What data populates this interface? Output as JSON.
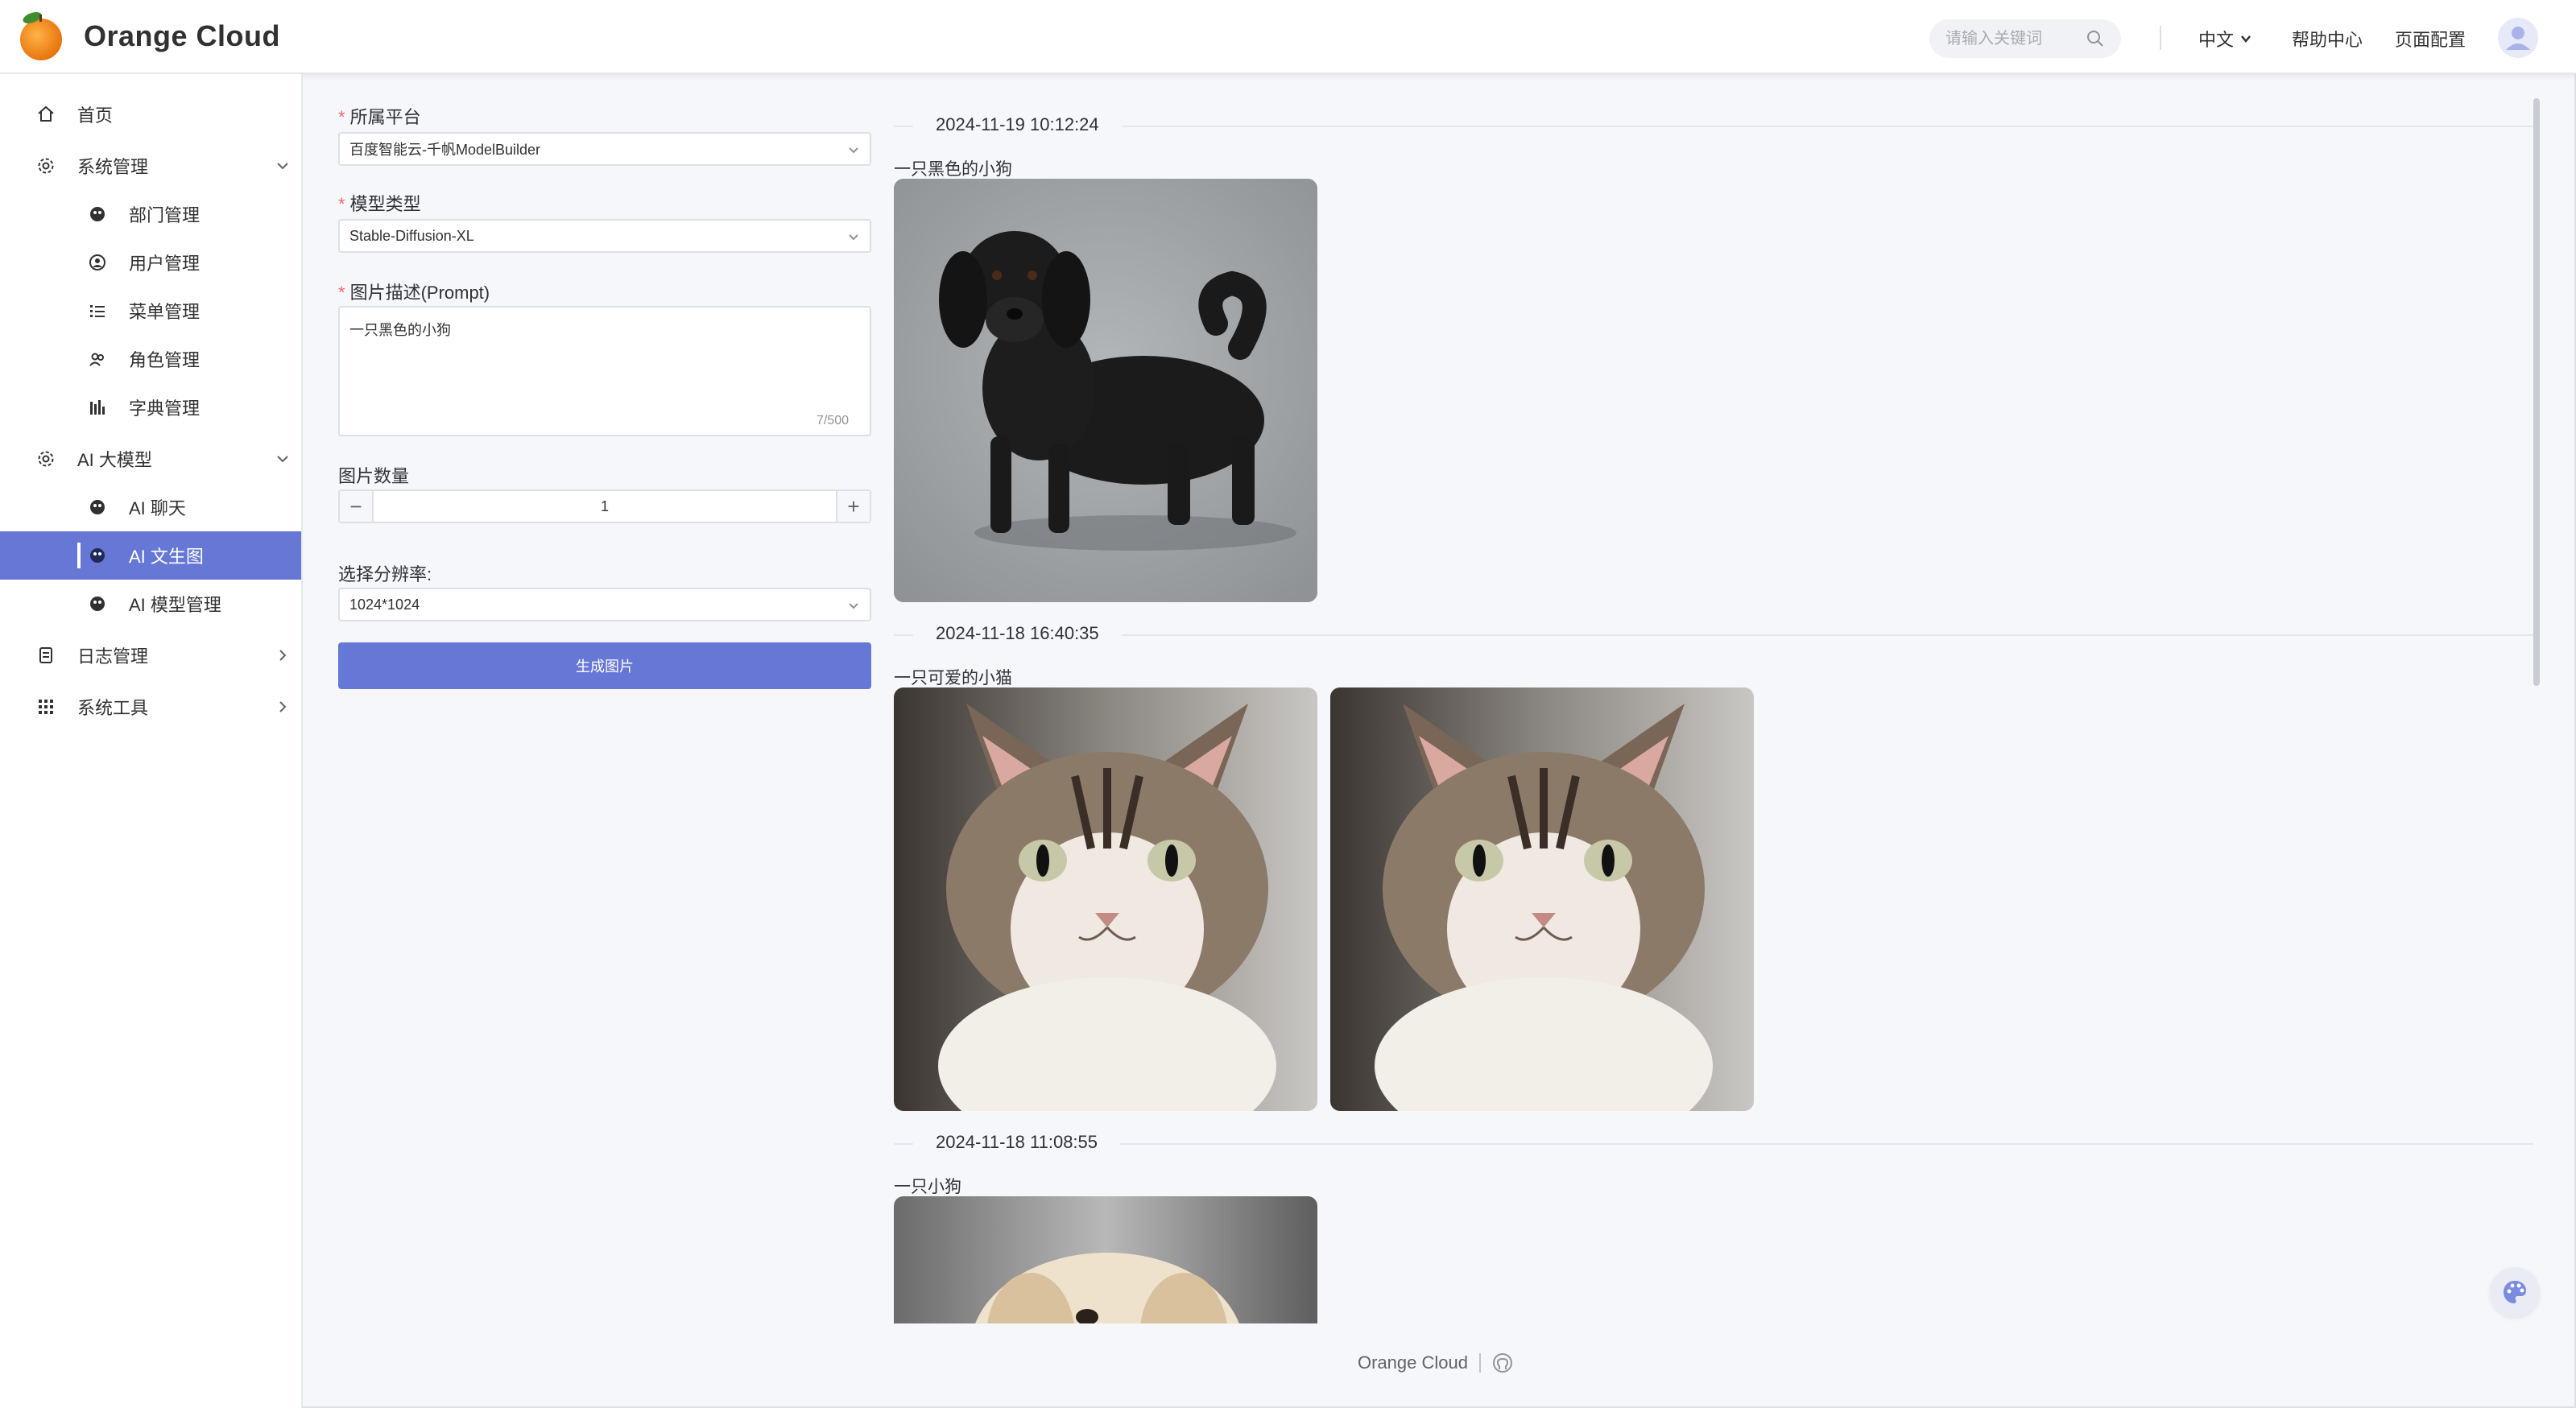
{
  "app": {
    "title": "Orange Cloud"
  },
  "header": {
    "search_placeholder": "请输入关键词",
    "language": "中文",
    "help": "帮助中心",
    "page_config": "页面配置"
  },
  "sidebar": {
    "items": [
      {
        "label": "首页",
        "icon": "home-icon"
      },
      {
        "label": "系统管理",
        "icon": "gear-icon"
      },
      {
        "label": "部门管理",
        "icon": "dept-icon"
      },
      {
        "label": "用户管理",
        "icon": "user-icon"
      },
      {
        "label": "菜单管理",
        "icon": "list-icon"
      },
      {
        "label": "角色管理",
        "icon": "role-icon"
      },
      {
        "label": "字典管理",
        "icon": "dict-icon"
      },
      {
        "label": "AI 大模型",
        "icon": "gear-icon"
      },
      {
        "label": "AI 聊天",
        "icon": "ai-chat-icon"
      },
      {
        "label": "AI 文生图",
        "icon": "ai-image-icon"
      },
      {
        "label": "AI 模型管理",
        "icon": "ai-model-icon"
      },
      {
        "label": "日志管理",
        "icon": "log-icon"
      },
      {
        "label": "系统工具",
        "icon": "grid-icon"
      }
    ]
  },
  "form": {
    "platform_label": "所属平台",
    "platform_value": "百度智能云-千帆ModelBuilder",
    "model_label": "模型类型",
    "model_value": "Stable-Diffusion-XL",
    "prompt_label": "图片描述(Prompt)",
    "prompt_value": "一只黑色的小狗",
    "prompt_counter": "7/500",
    "count_label": "图片数量",
    "count_value": "1",
    "resolution_label": "选择分辨率:",
    "resolution_value": "1024*1024",
    "generate_label": "生成图片"
  },
  "results": [
    {
      "date": "2024-11-19 10:12:24",
      "prompt": "一只黑色的小狗",
      "images": [
        "black-dog"
      ]
    },
    {
      "date": "2024-11-18 16:40:35",
      "prompt": "一只可爱的小猫",
      "images": [
        "kitten",
        "kitten"
      ]
    },
    {
      "date": "2024-11-18 11:08:55",
      "prompt": "一只小狗",
      "images": [
        "puppy"
      ]
    }
  ],
  "footer": {
    "text": "Orange Cloud"
  },
  "colors": {
    "accent": "#6777d6",
    "background": "#f5f7fb"
  }
}
